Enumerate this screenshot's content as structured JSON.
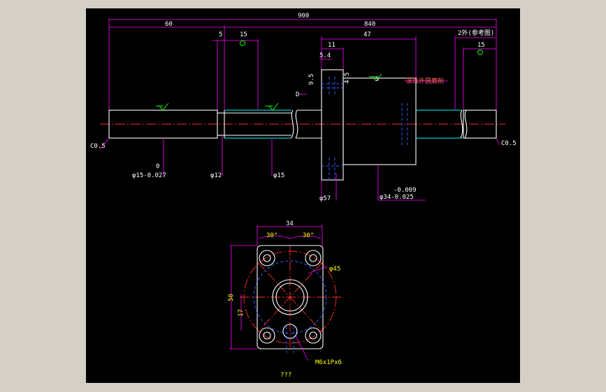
{
  "colors": {
    "background": "#000000",
    "dimension": "#ff00ff",
    "outline": "#ffffff",
    "hidden": "#2f5bff",
    "center": "#ff2a2a",
    "text_white": "#ffffff",
    "text_green": "#00ff00",
    "text_yellow": "#ffff00"
  },
  "side_view": {
    "dims": {
      "d900": "900",
      "d60": "60",
      "d840": "840",
      "d5": "5",
      "d15a": "15",
      "d47": "47",
      "d11": "11",
      "d54": "5.4",
      "d95": "9.5",
      "d45": "4.5",
      "d5b": "5",
      "d_right": "2外(参考图)",
      "d15b": "15",
      "d_label": "D",
      "note_red": "滚珠外圆磨削"
    },
    "chamfer_left": "C0.5",
    "chamfer_right": "C0.5",
    "tol_zero": "0",
    "dia15_tol": "φ15-0.027",
    "dia12": "φ12",
    "dia15": "φ15",
    "dia57": "φ57",
    "tol_upper": "-0.009",
    "dia34": "φ34-0.025"
  },
  "front_view": {
    "dims": {
      "d34": "34",
      "angle_left": "30°",
      "angle_right": "30°",
      "d50": "50",
      "d17": "17",
      "d45": "φ45"
    },
    "thread_note": "M6x1Px6",
    "caption": "???"
  }
}
